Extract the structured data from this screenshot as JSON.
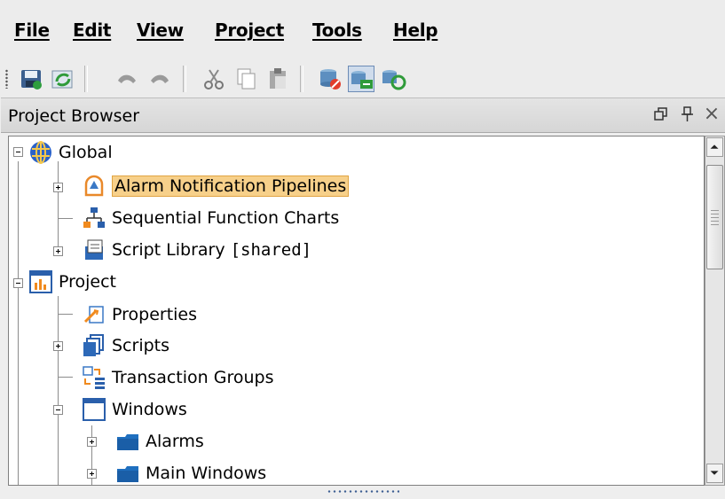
{
  "menubar": {
    "items": [
      {
        "label": "File"
      },
      {
        "label": "Edit"
      },
      {
        "label": "View"
      },
      {
        "label": "Project"
      },
      {
        "label": "Tools"
      },
      {
        "label": "Help"
      }
    ]
  },
  "toolbar": {
    "buttons": [
      {
        "icon": "save-icon"
      },
      {
        "icon": "refresh-icon"
      },
      {
        "icon": "undo-icon"
      },
      {
        "icon": "redo-icon"
      },
      {
        "icon": "cut-icon"
      },
      {
        "icon": "copy-icon"
      },
      {
        "icon": "paste-icon"
      },
      {
        "icon": "database-stop-icon"
      },
      {
        "icon": "comm-read-write-icon",
        "active": true
      },
      {
        "icon": "comm-refresh-icon"
      }
    ]
  },
  "panel": {
    "title": "Project Browser",
    "controls": [
      "restore-icon",
      "pin-icon",
      "close-icon"
    ],
    "close_glyph": "×"
  },
  "tree": {
    "nodes": [
      {
        "label": "Global",
        "icon": "globe-icon",
        "expanded": true
      },
      {
        "label": "Alarm Notification Pipelines",
        "icon": "alarm-pipeline-icon",
        "selected": true
      },
      {
        "label": "Sequential Function Charts",
        "icon": "sfc-icon"
      },
      {
        "label": "Script Library",
        "label_suffix": "[shared]",
        "icon": "script-library-icon"
      },
      {
        "label": "Project",
        "icon": "project-icon",
        "expanded": true
      },
      {
        "label": "Properties",
        "icon": "properties-icon"
      },
      {
        "label": "Scripts",
        "icon": "scripts-icon"
      },
      {
        "label": "Transaction Groups",
        "icon": "transaction-groups-icon"
      },
      {
        "label": "Windows",
        "icon": "windows-icon",
        "expanded": true
      },
      {
        "label": "Alarms",
        "icon": "folder-icon"
      },
      {
        "label": "Main Windows",
        "icon": "folder-icon"
      }
    ]
  },
  "colors": {
    "selection_bg": "#f7d08a",
    "selection_border": "#e0a443",
    "folder_blue": "#1f6fbf"
  }
}
